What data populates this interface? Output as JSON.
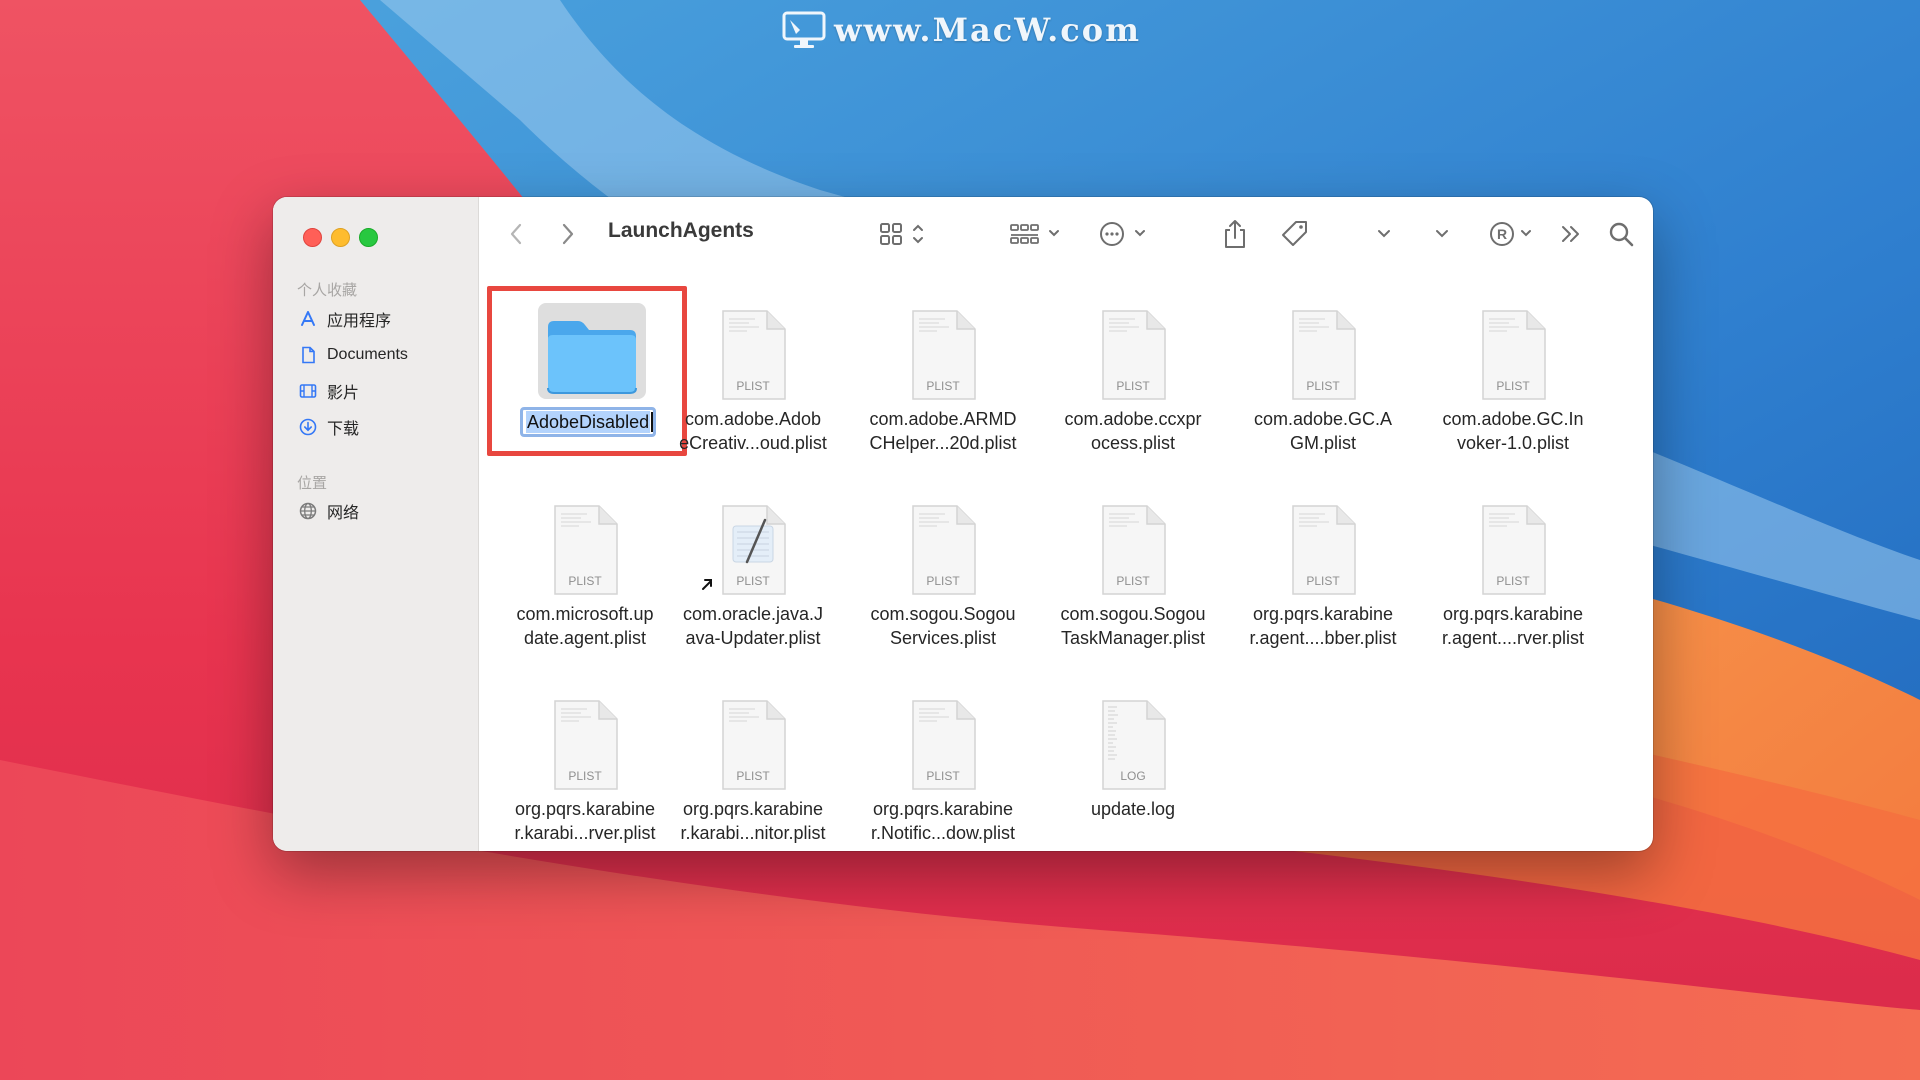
{
  "watermark": {
    "text": "www.MacW.com"
  },
  "window": {
    "title": "LaunchAgents",
    "sidebar": {
      "favorites_header": "个人收藏",
      "favorites": [
        {
          "label": "应用程序",
          "icon": "applications-icon"
        },
        {
          "label": "Documents",
          "icon": "document-icon"
        },
        {
          "label": "影片",
          "icon": "film-icon"
        },
        {
          "label": "下载",
          "icon": "download-icon"
        }
      ],
      "locations_header": "位置",
      "locations": [
        {
          "label": "网络",
          "icon": "network-icon"
        }
      ]
    },
    "toolbar": {
      "icons": [
        "back-icon",
        "forward-icon",
        "icon-view-icon",
        "group-icon",
        "action-more-icon",
        "share-icon",
        "tag-icon",
        "chevron-down-icon",
        "chevron-down-icon",
        "registered-icon",
        "overflow-icon",
        "search-icon"
      ],
      "registered_symbol": "®"
    },
    "files": [
      {
        "name_lines": [
          "AdobeDisabled"
        ],
        "kind": "folder",
        "selected": true,
        "renaming": true
      },
      {
        "name_lines": [
          "com.adobe.Adob",
          "eCreativ...oud.plist"
        ],
        "kind": "PLIST"
      },
      {
        "name_lines": [
          "com.adobe.ARMD",
          "CHelper...20d.plist"
        ],
        "kind": "PLIST"
      },
      {
        "name_lines": [
          "com.adobe.ccxpr",
          "ocess.plist"
        ],
        "kind": "PLIST"
      },
      {
        "name_lines": [
          "com.adobe.GC.A",
          "GM.plist"
        ],
        "kind": "PLIST"
      },
      {
        "name_lines": [
          "com.adobe.GC.In",
          "voker-1.0.plist"
        ],
        "kind": "PLIST"
      },
      {
        "name_lines": [
          "com.microsoft.up",
          "date.agent.plist"
        ],
        "kind": "PLIST"
      },
      {
        "name_lines": [
          "com.oracle.java.J",
          "ava-Updater.plist"
        ],
        "kind": "PLIST",
        "alias": true
      },
      {
        "name_lines": [
          "com.sogou.Sogou",
          "Services.plist"
        ],
        "kind": "PLIST"
      },
      {
        "name_lines": [
          "com.sogou.Sogou",
          "TaskManager.plist"
        ],
        "kind": "PLIST"
      },
      {
        "name_lines": [
          "org.pqrs.karabine",
          "r.agent....bber.plist"
        ],
        "kind": "PLIST"
      },
      {
        "name_lines": [
          "org.pqrs.karabine",
          "r.agent....rver.plist"
        ],
        "kind": "PLIST"
      },
      {
        "name_lines": [
          "org.pqrs.karabine",
          "r.karabi...rver.plist"
        ],
        "kind": "PLIST"
      },
      {
        "name_lines": [
          "org.pqrs.karabine",
          "r.karabi...nitor.plist"
        ],
        "kind": "PLIST"
      },
      {
        "name_lines": [
          "org.pqrs.karabine",
          "r.Notific...dow.plist"
        ],
        "kind": "PLIST"
      },
      {
        "name_lines": [
          "update.log"
        ],
        "kind": "LOG"
      }
    ]
  },
  "colors": {
    "folder_blue": "#5cb8f6",
    "selection_outline": "#e8473f",
    "rename_highlight": "#b3d3fc"
  }
}
